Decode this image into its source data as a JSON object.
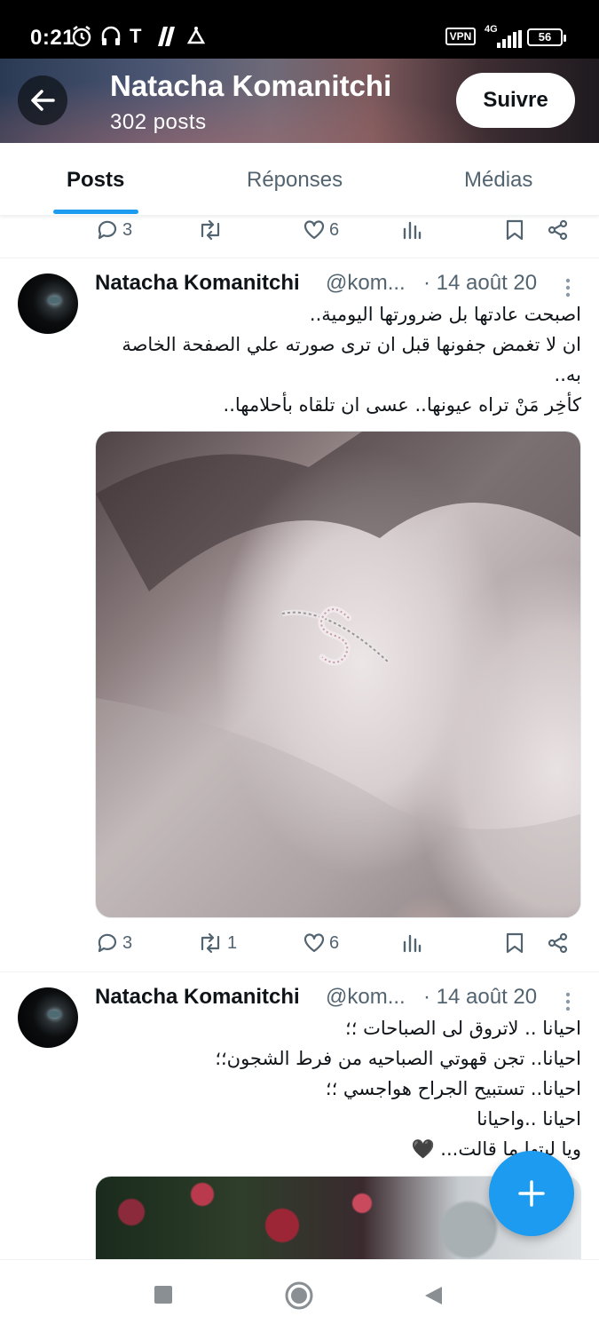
{
  "status_bar": {
    "time": "0:21",
    "vpn": "VPN",
    "network": "4G",
    "battery": "56"
  },
  "header": {
    "name": "Natacha Komanitchi",
    "post_count": "302 posts",
    "follow_label": "Suivre"
  },
  "tabs": [
    {
      "label": "Posts",
      "active": true
    },
    {
      "label": "Réponses",
      "active": false
    },
    {
      "label": "Médias",
      "active": false
    }
  ],
  "prev_tweet_actions": {
    "replies": "3",
    "retweets": "",
    "likes": "6"
  },
  "tweets": [
    {
      "name": "Natacha Komanitchi",
      "handle": "@kom...",
      "date": "· 14 août 20",
      "lines": [
        "اصبحت عادتها بل ضرورتها اليومية..",
        "ان لا تغمض جفونها قبل ان ترى صورته علي الصفحة الخاصة",
        "به..",
        "كأخِر مَنْ تراه عيونها.. عسى ان تلقاه بأحلامها.."
      ],
      "actions": {
        "replies": "3",
        "retweets": "1",
        "likes": "6"
      }
    },
    {
      "name": "Natacha Komanitchi",
      "handle": "@kom...",
      "date": "· 14 août 20",
      "lines": [
        "احيانا .. لاتروق لى الصباحات ؛؛",
        "احيانا.. تجن قهوتي الصباحيه من فرط الشجون؛؛",
        "احيانا.. تستبيح الجراح هواجسي ؛؛",
        "احيانا ..واحيانا",
        "ويا ليتها ما قالت... 🖤"
      ]
    }
  ],
  "colors": {
    "accent": "#1d9bf0",
    "text": "#0f1419",
    "secondary": "#536471"
  },
  "icons": [
    "back-arrow-icon",
    "reply-icon",
    "retweet-icon",
    "like-icon",
    "views-icon",
    "bookmark-icon",
    "share-icon",
    "more-icon",
    "compose-plus-icon",
    "nav-recents-icon",
    "nav-home-icon",
    "nav-back-icon"
  ]
}
